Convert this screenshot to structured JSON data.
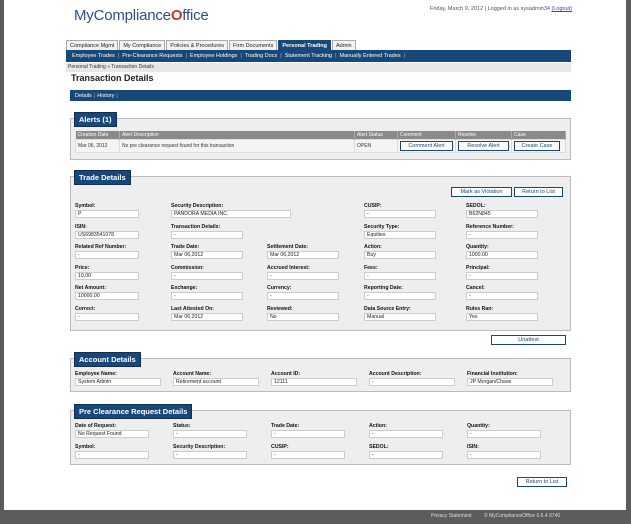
{
  "header": {
    "logo_text": "MyCompliance",
    "logo_check": "O",
    "logo_text2": "ffice",
    "date": "Friday, March 9, 2012",
    "logged_in": "Logged in as sysadmin34",
    "logout": "(Logout)"
  },
  "main_tabs": [
    "Compliance Mgmt",
    "My Compliance",
    "Policies & Procedures",
    "Firm Documents",
    "Personal Trading",
    "Admin"
  ],
  "sub_nav": [
    "Employee Trades",
    "Pre-Clearance Requests",
    "Employee Holdings",
    "Trading Docs",
    "Statement Tracking",
    "Manually Entered Trades"
  ],
  "breadcrumb": "Personal Trading » Transaction Details",
  "page_title": "Transaction Details",
  "detail_nav": [
    "Details",
    "History"
  ],
  "alerts": {
    "title": "Alerts (1)",
    "columns": [
      "Creation Date",
      "Alert Description",
      "Alert Status",
      "Comment",
      "Resolve",
      "Case"
    ],
    "row": {
      "date": "Mar 06, 2012",
      "description": "No pre clearance request found for this transaction",
      "status": "OPEN",
      "comment_btn": "Comment Alert",
      "resolve_btn": "Resolve Alert",
      "case_btn": "Create Case"
    }
  },
  "trade": {
    "title": "Trade Details",
    "mark_btn": "Mark as Violation",
    "return_btn": "Return to List",
    "unattest_btn": "Unattest",
    "fields": {
      "symbol": {
        "label": "Symbol:",
        "value": "P"
      },
      "security_description": {
        "label": "Security Description:",
        "value": "PANDORA MEDIA INC."
      },
      "cusip": {
        "label": "CUSIP:",
        "value": "-"
      },
      "sedol": {
        "label": "SEDOL:",
        "value": "B62N845"
      },
      "isin": {
        "label": "ISIN:",
        "value": "US6983541078"
      },
      "transaction_details": {
        "label": "Transaction Details:",
        "value": "-"
      },
      "security_type": {
        "label": "Security Type:",
        "value": "Equities"
      },
      "reference_number": {
        "label": "Reference Number:",
        "value": "-"
      },
      "related_ref": {
        "label": "Related Ref Number:",
        "value": "-"
      },
      "trade_date": {
        "label": "Trade Date:",
        "value": "Mar 06,2012"
      },
      "settlement_date": {
        "label": "Settlement Date:",
        "value": "Mar 06,2012"
      },
      "action": {
        "label": "Action:",
        "value": "Buy"
      },
      "quantity": {
        "label": "Quantity:",
        "value": "1000.00"
      },
      "price": {
        "label": "Price:",
        "value": "10.00"
      },
      "commission": {
        "label": "Commission:",
        "value": "-"
      },
      "accrued_interest": {
        "label": "Accrued Interest:",
        "value": "-"
      },
      "fees": {
        "label": "Fees:",
        "value": "-"
      },
      "principal": {
        "label": "Principal:",
        "value": "-"
      },
      "net_amount": {
        "label": "Net Amount:",
        "value": "10000.00"
      },
      "exchange": {
        "label": "Exchange:",
        "value": "-"
      },
      "currency": {
        "label": "Currency:",
        "value": "-"
      },
      "reporting_date": {
        "label": "Reporting Date:",
        "value": "-"
      },
      "cancel": {
        "label": "Cancel:",
        "value": "-"
      },
      "correct": {
        "label": "Correct:",
        "value": "-"
      },
      "last_attested": {
        "label": "Last Attested On:",
        "value": "Mar 06,2012"
      },
      "reviewed": {
        "label": "Reviewed:",
        "value": "No"
      },
      "data_source": {
        "label": "Data Source Entry:",
        "value": "Manual"
      },
      "rules_ran": {
        "label": "Rules Ran:",
        "value": "Yes"
      }
    }
  },
  "account": {
    "title": "Account Details",
    "fields": {
      "employee_name": {
        "label": "Employee Name:",
        "value": "System Admin"
      },
      "account_name": {
        "label": "Account Name:",
        "value": "Retirement account"
      },
      "account_id": {
        "label": "Account ID:",
        "value": "12111"
      },
      "account_description": {
        "label": "Account Description:",
        "value": "-"
      },
      "financial_institution": {
        "label": "Financial Institution:",
        "value": "JP Morgan/Chase"
      }
    }
  },
  "preclear": {
    "title": "Pre Clearance Request Details",
    "fields": {
      "date_of_request": {
        "label": "Date of Request:",
        "value": "No Request Found"
      },
      "status": {
        "label": "Status:",
        "value": "-"
      },
      "trade_date": {
        "label": "Trade Date:",
        "value": "-"
      },
      "action": {
        "label": "Action:",
        "value": "-"
      },
      "quantity": {
        "label": "Quantity:",
        "value": "-"
      },
      "symbol": {
        "label": "Symbol:",
        "value": "-"
      },
      "security_description": {
        "label": "Security Description:",
        "value": "-"
      },
      "cusip": {
        "label": "CUSIP:",
        "value": "-"
      },
      "sedol": {
        "label": "SEDOL:",
        "value": "-"
      },
      "isin": {
        "label": "ISIN:",
        "value": "-"
      }
    }
  },
  "bottom_return_btn": "Return to List",
  "footer": {
    "privacy": "Privacy Statement",
    "copyright": "© MyComplianceOffice 6.6.4.9740"
  },
  "colors": {
    "brand": "#18477a",
    "accent_red": "#c0392b"
  }
}
